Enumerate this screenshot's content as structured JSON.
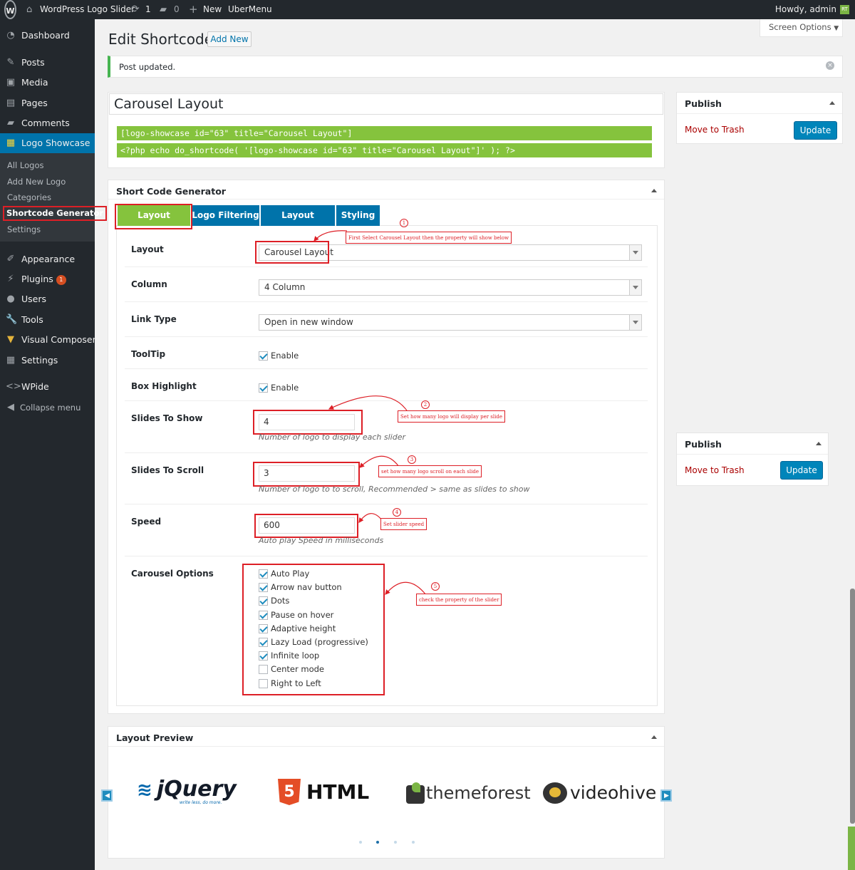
{
  "admin_bar": {
    "site_name": "WordPress Logo Slider",
    "updates_count": "1",
    "comments_count": "0",
    "new_label": "New",
    "ubermenu_label": "UberMenu",
    "howdy": "Howdy, admin",
    "avatar_text": "RT"
  },
  "sidebar": {
    "dashboard": "Dashboard",
    "posts": "Posts",
    "media": "Media",
    "pages": "Pages",
    "comments": "Comments",
    "logo_showcase": "Logo Showcase",
    "submenu": [
      "All Logos",
      "Add New Logo",
      "Categories",
      "Shortcode Generator",
      "Settings"
    ],
    "appearance": "Appearance",
    "plugins": "Plugins",
    "plugins_badge": "1",
    "users": "Users",
    "tools": "Tools",
    "visual_composer": "Visual Composer",
    "settings": "Settings",
    "wpide": "WPide",
    "collapse": "Collapse menu"
  },
  "header": {
    "screen_options": "Screen Options",
    "title": "Edit Shortcode",
    "add_new": "Add New",
    "notice": "Post updated."
  },
  "post": {
    "title": "Carousel Layout",
    "shortcode": "[logo-showcase id=\"63\" title=\"Carousel Layout\"]",
    "php_code": "<?php echo do_shortcode( '[logo-showcase id=\"63\" title=\"Carousel Layout\"]' ); ?>"
  },
  "generator": {
    "title": "Short Code Generator",
    "tabs": [
      "Layout Settings",
      "Logo Filtering",
      "Layout Building",
      "Styling"
    ],
    "fields": {
      "layout_label": "Layout",
      "layout_value": "Carousel Layout",
      "column_label": "Column",
      "column_value": "4 Column",
      "link_type_label": "Link Type",
      "link_type_value": "Open in new window",
      "tooltip_label": "ToolTip",
      "tooltip_option": "Enable",
      "box_highlight_label": "Box Highlight",
      "box_highlight_option": "Enable",
      "slides_show_label": "Slides To Show",
      "slides_show_value": "4",
      "slides_show_desc": "Number of logo to display each slider",
      "slides_scroll_label": "Slides To Scroll",
      "slides_scroll_value": "3",
      "slides_scroll_desc": "Number of logo to to scroll, Recommended > same as slides to show",
      "speed_label": "Speed",
      "speed_value": "600",
      "speed_desc": "Auto play Speed in milliseconds",
      "carousel_label": "Carousel Options"
    },
    "carousel_options": [
      {
        "label": "Auto Play",
        "checked": true
      },
      {
        "label": "Arrow nav button",
        "checked": true
      },
      {
        "label": "Dots",
        "checked": true
      },
      {
        "label": "Pause on hover",
        "checked": true
      },
      {
        "label": "Adaptive height",
        "checked": true
      },
      {
        "label": "Lazy Load (progressive)",
        "checked": true
      },
      {
        "label": "Infinite loop",
        "checked": true
      },
      {
        "label": "Center mode",
        "checked": false
      },
      {
        "label": "Right to Left",
        "checked": false
      }
    ]
  },
  "annotations": {
    "n1": "1",
    "a1": "First Select Carousel Layout then the property will show below",
    "n2": "2",
    "a2": "Set how many logo will display per slide",
    "n3": "3",
    "a3": "set how many logo scroll on each slide",
    "n4": "4",
    "a4": "Set slider speed",
    "n5": "5",
    "a5": "check the property of the slider"
  },
  "publish": {
    "title": "Publish",
    "trash": "Move to Trash",
    "update": "Update"
  },
  "preview": {
    "title": "Layout Preview",
    "logos": {
      "jquery": "jQuery",
      "jquery_tagline": "write less, do more.",
      "html": "HTML",
      "html_badge": "5",
      "themeforest": "themeforest",
      "videohive": "videohive"
    },
    "active_dot": 2
  },
  "colors": {
    "admin_dark": "#23282d",
    "accent_blue": "#0073aa",
    "accent_green": "#85c33d",
    "annotation_red": "#dd1f26"
  }
}
